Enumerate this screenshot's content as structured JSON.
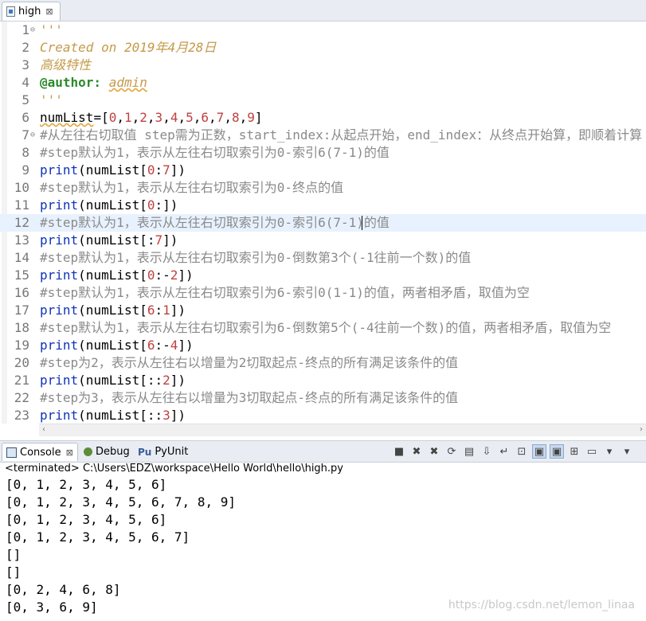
{
  "editor_tab": {
    "title": "high",
    "close": "⊠"
  },
  "code_lines": [
    {
      "num": "1",
      "fold": "⊖",
      "segments": [
        {
          "cls": "c-doc",
          "text": "'''"
        }
      ]
    },
    {
      "num": "2",
      "fold": "",
      "segments": [
        {
          "cls": "c-doc",
          "text": "Created on 2019年4月28日"
        }
      ]
    },
    {
      "num": "3",
      "fold": "",
      "segments": [
        {
          "cls": "c-doc",
          "text": "高级特性"
        }
      ]
    },
    {
      "num": "4",
      "fold": "",
      "segments": [
        {
          "cls": "c-deco",
          "text": "@author:"
        },
        {
          "cls": "c-norm",
          "text": " "
        },
        {
          "cls": "c-docwave",
          "text": "admin"
        }
      ]
    },
    {
      "num": "5",
      "fold": "",
      "segments": [
        {
          "cls": "c-doc",
          "text": "'''"
        }
      ]
    },
    {
      "num": "6",
      "fold": "",
      "segments": [
        {
          "cls": "c-norm c-wave",
          "text": "numList"
        },
        {
          "cls": "c-norm",
          "text": "=["
        },
        {
          "cls": "c-num",
          "text": "0"
        },
        {
          "cls": "c-norm",
          "text": ","
        },
        {
          "cls": "c-num",
          "text": "1"
        },
        {
          "cls": "c-norm",
          "text": ","
        },
        {
          "cls": "c-num",
          "text": "2"
        },
        {
          "cls": "c-norm",
          "text": ","
        },
        {
          "cls": "c-num",
          "text": "3"
        },
        {
          "cls": "c-norm",
          "text": ","
        },
        {
          "cls": "c-num",
          "text": "4"
        },
        {
          "cls": "c-norm",
          "text": ","
        },
        {
          "cls": "c-num",
          "text": "5"
        },
        {
          "cls": "c-norm",
          "text": ","
        },
        {
          "cls": "c-num",
          "text": "6"
        },
        {
          "cls": "c-norm",
          "text": ","
        },
        {
          "cls": "c-num",
          "text": "7"
        },
        {
          "cls": "c-norm",
          "text": ","
        },
        {
          "cls": "c-num",
          "text": "8"
        },
        {
          "cls": "c-norm",
          "text": ","
        },
        {
          "cls": "c-num",
          "text": "9"
        },
        {
          "cls": "c-norm",
          "text": "]"
        }
      ]
    },
    {
      "num": "7",
      "fold": "⊖",
      "segments": [
        {
          "cls": "c-comment",
          "text": "#从左往右切取值 step需为正数，start_index:从起点开始，end_index：从终点开始算，即顺着计算"
        }
      ]
    },
    {
      "num": "8",
      "fold": "",
      "segments": [
        {
          "cls": "c-comment",
          "text": "#step默认为1，表示从左往右切取索引为0-索引6(7-1)的值"
        }
      ]
    },
    {
      "num": "9",
      "fold": "",
      "segments": [
        {
          "cls": "c-kw",
          "text": "print"
        },
        {
          "cls": "c-norm",
          "text": "(numList["
        },
        {
          "cls": "c-num",
          "text": "0"
        },
        {
          "cls": "c-norm",
          "text": ":"
        },
        {
          "cls": "c-num",
          "text": "7"
        },
        {
          "cls": "c-norm",
          "text": "])"
        }
      ]
    },
    {
      "num": "10",
      "fold": "",
      "segments": [
        {
          "cls": "c-comment",
          "text": "#step默认为1，表示从左往右切取索引为0-终点的值"
        }
      ]
    },
    {
      "num": "11",
      "fold": "",
      "segments": [
        {
          "cls": "c-kw",
          "text": "print"
        },
        {
          "cls": "c-norm",
          "text": "(numList["
        },
        {
          "cls": "c-num",
          "text": "0"
        },
        {
          "cls": "c-norm",
          "text": ":])"
        }
      ]
    },
    {
      "num": "12",
      "fold": "",
      "current": true,
      "segments": [
        {
          "cls": "c-comment",
          "text": "#step默认为1，表示从左往右切取索引为0-索引6(7-1)的值"
        }
      ]
    },
    {
      "num": "13",
      "fold": "",
      "segments": [
        {
          "cls": "c-kw",
          "text": "print"
        },
        {
          "cls": "c-norm",
          "text": "(numList[:"
        },
        {
          "cls": "c-num",
          "text": "7"
        },
        {
          "cls": "c-norm",
          "text": "])"
        }
      ]
    },
    {
      "num": "14",
      "fold": "",
      "segments": [
        {
          "cls": "c-comment",
          "text": "#step默认为1，表示从左往右切取索引为0-倒数第3个(-1往前一个数)的值"
        }
      ]
    },
    {
      "num": "15",
      "fold": "",
      "segments": [
        {
          "cls": "c-kw",
          "text": "print"
        },
        {
          "cls": "c-norm",
          "text": "(numList["
        },
        {
          "cls": "c-num",
          "text": "0"
        },
        {
          "cls": "c-norm",
          "text": ":-"
        },
        {
          "cls": "c-num",
          "text": "2"
        },
        {
          "cls": "c-norm",
          "text": "])"
        }
      ]
    },
    {
      "num": "16",
      "fold": "",
      "segments": [
        {
          "cls": "c-comment",
          "text": "#step默认为1，表示从左往右切取索引为6-索引0(1-1)的值，两者相矛盾，取值为空"
        }
      ]
    },
    {
      "num": "17",
      "fold": "",
      "segments": [
        {
          "cls": "c-kw",
          "text": "print"
        },
        {
          "cls": "c-norm",
          "text": "(numList["
        },
        {
          "cls": "c-num",
          "text": "6"
        },
        {
          "cls": "c-norm",
          "text": ":"
        },
        {
          "cls": "c-num",
          "text": "1"
        },
        {
          "cls": "c-norm",
          "text": "])"
        }
      ]
    },
    {
      "num": "18",
      "fold": "",
      "segments": [
        {
          "cls": "c-comment",
          "text": "#step默认为1，表示从左往右切取索引为6-倒数第5个(-4往前一个数)的值，两者相矛盾，取值为空"
        }
      ]
    },
    {
      "num": "19",
      "fold": "",
      "segments": [
        {
          "cls": "c-kw",
          "text": "print"
        },
        {
          "cls": "c-norm",
          "text": "(numList["
        },
        {
          "cls": "c-num",
          "text": "6"
        },
        {
          "cls": "c-norm",
          "text": ":-"
        },
        {
          "cls": "c-num",
          "text": "4"
        },
        {
          "cls": "c-norm",
          "text": "])"
        }
      ]
    },
    {
      "num": "20",
      "fold": "",
      "segments": [
        {
          "cls": "c-comment",
          "text": "#step为2，表示从左往右以增量为2切取起点-终点的所有满足该条件的值"
        }
      ]
    },
    {
      "num": "21",
      "fold": "",
      "segments": [
        {
          "cls": "c-kw",
          "text": "print"
        },
        {
          "cls": "c-norm",
          "text": "(numList[::"
        },
        {
          "cls": "c-num",
          "text": "2"
        },
        {
          "cls": "c-norm",
          "text": "])"
        }
      ]
    },
    {
      "num": "22",
      "fold": "",
      "segments": [
        {
          "cls": "c-comment",
          "text": "#step为3，表示从左往右以增量为3切取起点-终点的所有满足该条件的值"
        }
      ]
    },
    {
      "num": "23",
      "fold": "",
      "segments": [
        {
          "cls": "c-kw",
          "text": "print"
        },
        {
          "cls": "c-norm",
          "text": "(numList[::"
        },
        {
          "cls": "c-num",
          "text": "3"
        },
        {
          "cls": "c-norm",
          "text": "])"
        }
      ]
    }
  ],
  "scrollbar": {
    "left_arrow": "‹",
    "right_arrow": "›"
  },
  "console_tabs": [
    {
      "id": "console",
      "label": "Console",
      "close": "⊠"
    },
    {
      "id": "debug",
      "label": "Debug"
    },
    {
      "id": "pyunit",
      "label": "PyUnit",
      "icon_text": "Pu"
    }
  ],
  "console_toolbar": [
    {
      "name": "stop-icon",
      "glyph": "■"
    },
    {
      "name": "remove-launch-icon",
      "glyph": "✖"
    },
    {
      "name": "remove-all-icon",
      "glyph": "✖"
    },
    {
      "name": "relaunch-icon",
      "glyph": "⟳"
    },
    {
      "name": "clear-console-icon",
      "glyph": "▤"
    },
    {
      "name": "scroll-lock-icon",
      "glyph": "⇩"
    },
    {
      "name": "word-wrap-icon",
      "glyph": "↵"
    },
    {
      "name": "pin-console-icon",
      "glyph": "⊡"
    },
    {
      "name": "show-on-stdout-icon",
      "glyph": "▣",
      "on": true
    },
    {
      "name": "show-on-stderr-icon",
      "glyph": "▣",
      "on": true
    },
    {
      "name": "new-console-icon",
      "glyph": "⊞"
    },
    {
      "name": "display-console-icon",
      "glyph": "▭"
    },
    {
      "name": "display-console-dropdown-icon",
      "glyph": "▾"
    },
    {
      "name": "view-menu-icon",
      "glyph": "▾"
    }
  ],
  "console_status": "<terminated> C:\\Users\\EDZ\\workspace\\Hello World\\hello\\high.py",
  "console_output": [
    "[0, 1, 2, 3, 4, 5, 6]",
    "[0, 1, 2, 3, 4, 5, 6, 7, 8, 9]",
    "[0, 1, 2, 3, 4, 5, 6]",
    "[0, 1, 2, 3, 4, 5, 6, 7]",
    "[]",
    "[]",
    "[0, 2, 4, 6, 8]",
    "[0, 3, 6, 9]"
  ],
  "watermark": "https://blog.csdn.net/lemon_linaa"
}
